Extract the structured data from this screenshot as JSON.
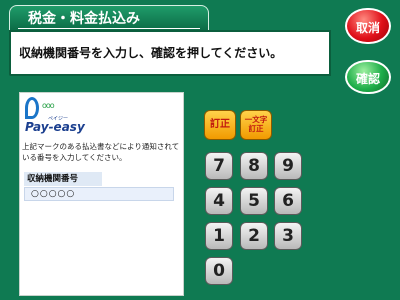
{
  "header": {
    "title": "税金・料金払込み"
  },
  "instruction": "収納機関番号を入力し、確認を押してください。",
  "buttons": {
    "cancel": "取消",
    "confirm": "確認"
  },
  "logo": {
    "text": "Pay-easy",
    "dots": "ooo",
    "sub": "ペイジー"
  },
  "panel": {
    "help_text": "上記マークのある払込書などにより通知されている番号を入力してください。",
    "field_label": "収納機関番号",
    "field_value": "○○○○○"
  },
  "keypad": {
    "correct": "訂正",
    "one_char_line1": "一文字",
    "one_char_line2": "訂正",
    "row1": [
      "7",
      "8",
      "9"
    ],
    "row2": [
      "4",
      "5",
      "6"
    ],
    "row3": [
      "1",
      "2",
      "3"
    ],
    "zero": "0"
  }
}
